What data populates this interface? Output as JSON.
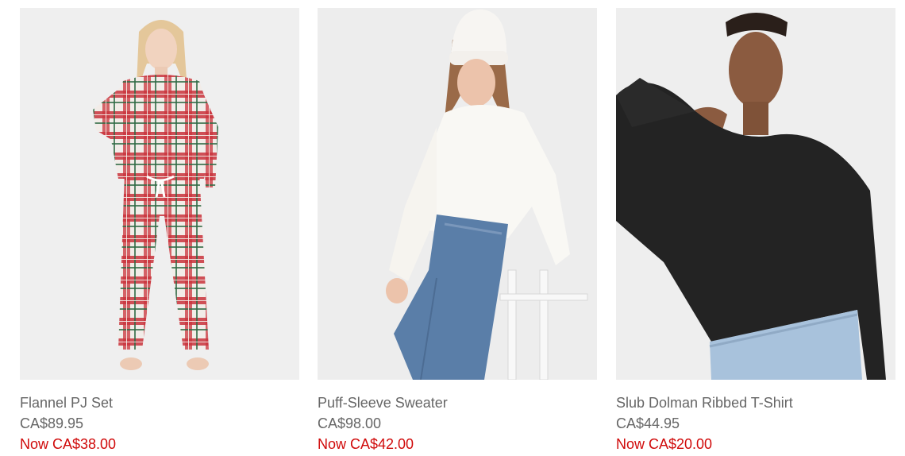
{
  "products": [
    {
      "name": "Flannel PJ Set",
      "price": "CA$89.95",
      "sale_price": "Now CA$38.00",
      "image": "woman-in-red-plaid-flannel-pajamas"
    },
    {
      "name": "Puff-Sleeve Sweater",
      "price": "CA$98.00",
      "sale_price": "Now CA$42.00",
      "image": "woman-in-white-sweater-and-beanie-with-blue-jeans"
    },
    {
      "name": "Slub Dolman Ribbed T-Shirt",
      "price": "CA$44.95",
      "sale_price": "Now CA$20.00",
      "image": "woman-in-black-long-sleeve-t-shirt"
    }
  ],
  "colors": {
    "text": "#666666",
    "sale": "#d00a0a",
    "photo_background": "#efefef"
  }
}
